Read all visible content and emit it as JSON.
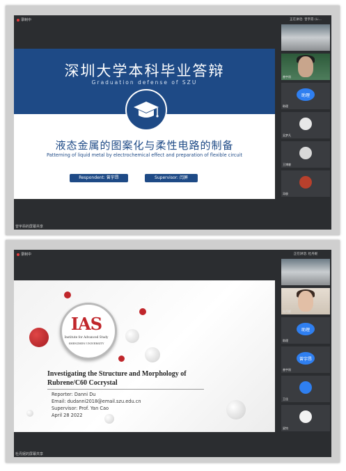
{
  "frames": [
    {
      "recording_label": "录制中",
      "gallery_title": "正在讲话: 曾宇昂 (Li...",
      "slide": {
        "title_cn": "深圳大学本科毕业答辩",
        "title_en": "Graduation defense of SZU",
        "subtitle_cn": "液态金属的图案化与柔性电路的制备",
        "subtitle_en": "Patterning of liquid metal by electrochemical effect and preparation of flexible circuit",
        "respondent": "Respondent: 曾宇昂",
        "supervisor": "Supervisor: 闫屏"
      },
      "participants": [
        {
          "name": "",
          "type": "video-room"
        },
        {
          "name": "曾宇昂",
          "type": "video-face"
        },
        {
          "name": "助理",
          "label": "助理",
          "type": "button"
        },
        {
          "name": "吴梦凡",
          "type": "avatar",
          "color": "#e8e8e8"
        },
        {
          "name": "王博睿",
          "type": "avatar",
          "color": "#d9d9d9"
        },
        {
          "name": "邓俊",
          "type": "avatar",
          "color": "#b8402c"
        }
      ],
      "share_label": "曾宇昂的屏幕共享"
    },
    {
      "recording_label": "录制中",
      "gallery_title": "正在讲话: 杜丹妮",
      "slide": {
        "logo": "IAS",
        "institute": "Institute for Advanced Study",
        "university": "SHENZHEN UNIVERSITY",
        "title_line1": "Investigating the Structure and Morphology of",
        "title_line2": "Rubrene/C60 Cocrystal",
        "reporter": "Reporter: Danni Du",
        "email": "Email: dudanni2018@email.szu.edu.cn",
        "supervisor": "Supervisor: Prof. Yan Cao",
        "date": "April 28 2022"
      },
      "participants": [
        {
          "name": "",
          "type": "video-room"
        },
        {
          "name": "杜丹妮",
          "type": "video-face"
        },
        {
          "name": "助理",
          "label": "助理",
          "type": "button"
        },
        {
          "name": "曾宇昂",
          "label": "曾宇昂",
          "type": "button"
        },
        {
          "name": "王佳",
          "type": "avatar",
          "color": "#2f7ff0"
        },
        {
          "name": "梁钧",
          "type": "avatar",
          "color": "#f2f2f2"
        }
      ],
      "share_label": "杜丹妮的屏幕共享"
    }
  ],
  "colors": {
    "navy": "#1e4a86",
    "ias_red": "#c0262b",
    "meeting_bg": "#2b2d30",
    "button_blue": "#2f7ff0"
  }
}
